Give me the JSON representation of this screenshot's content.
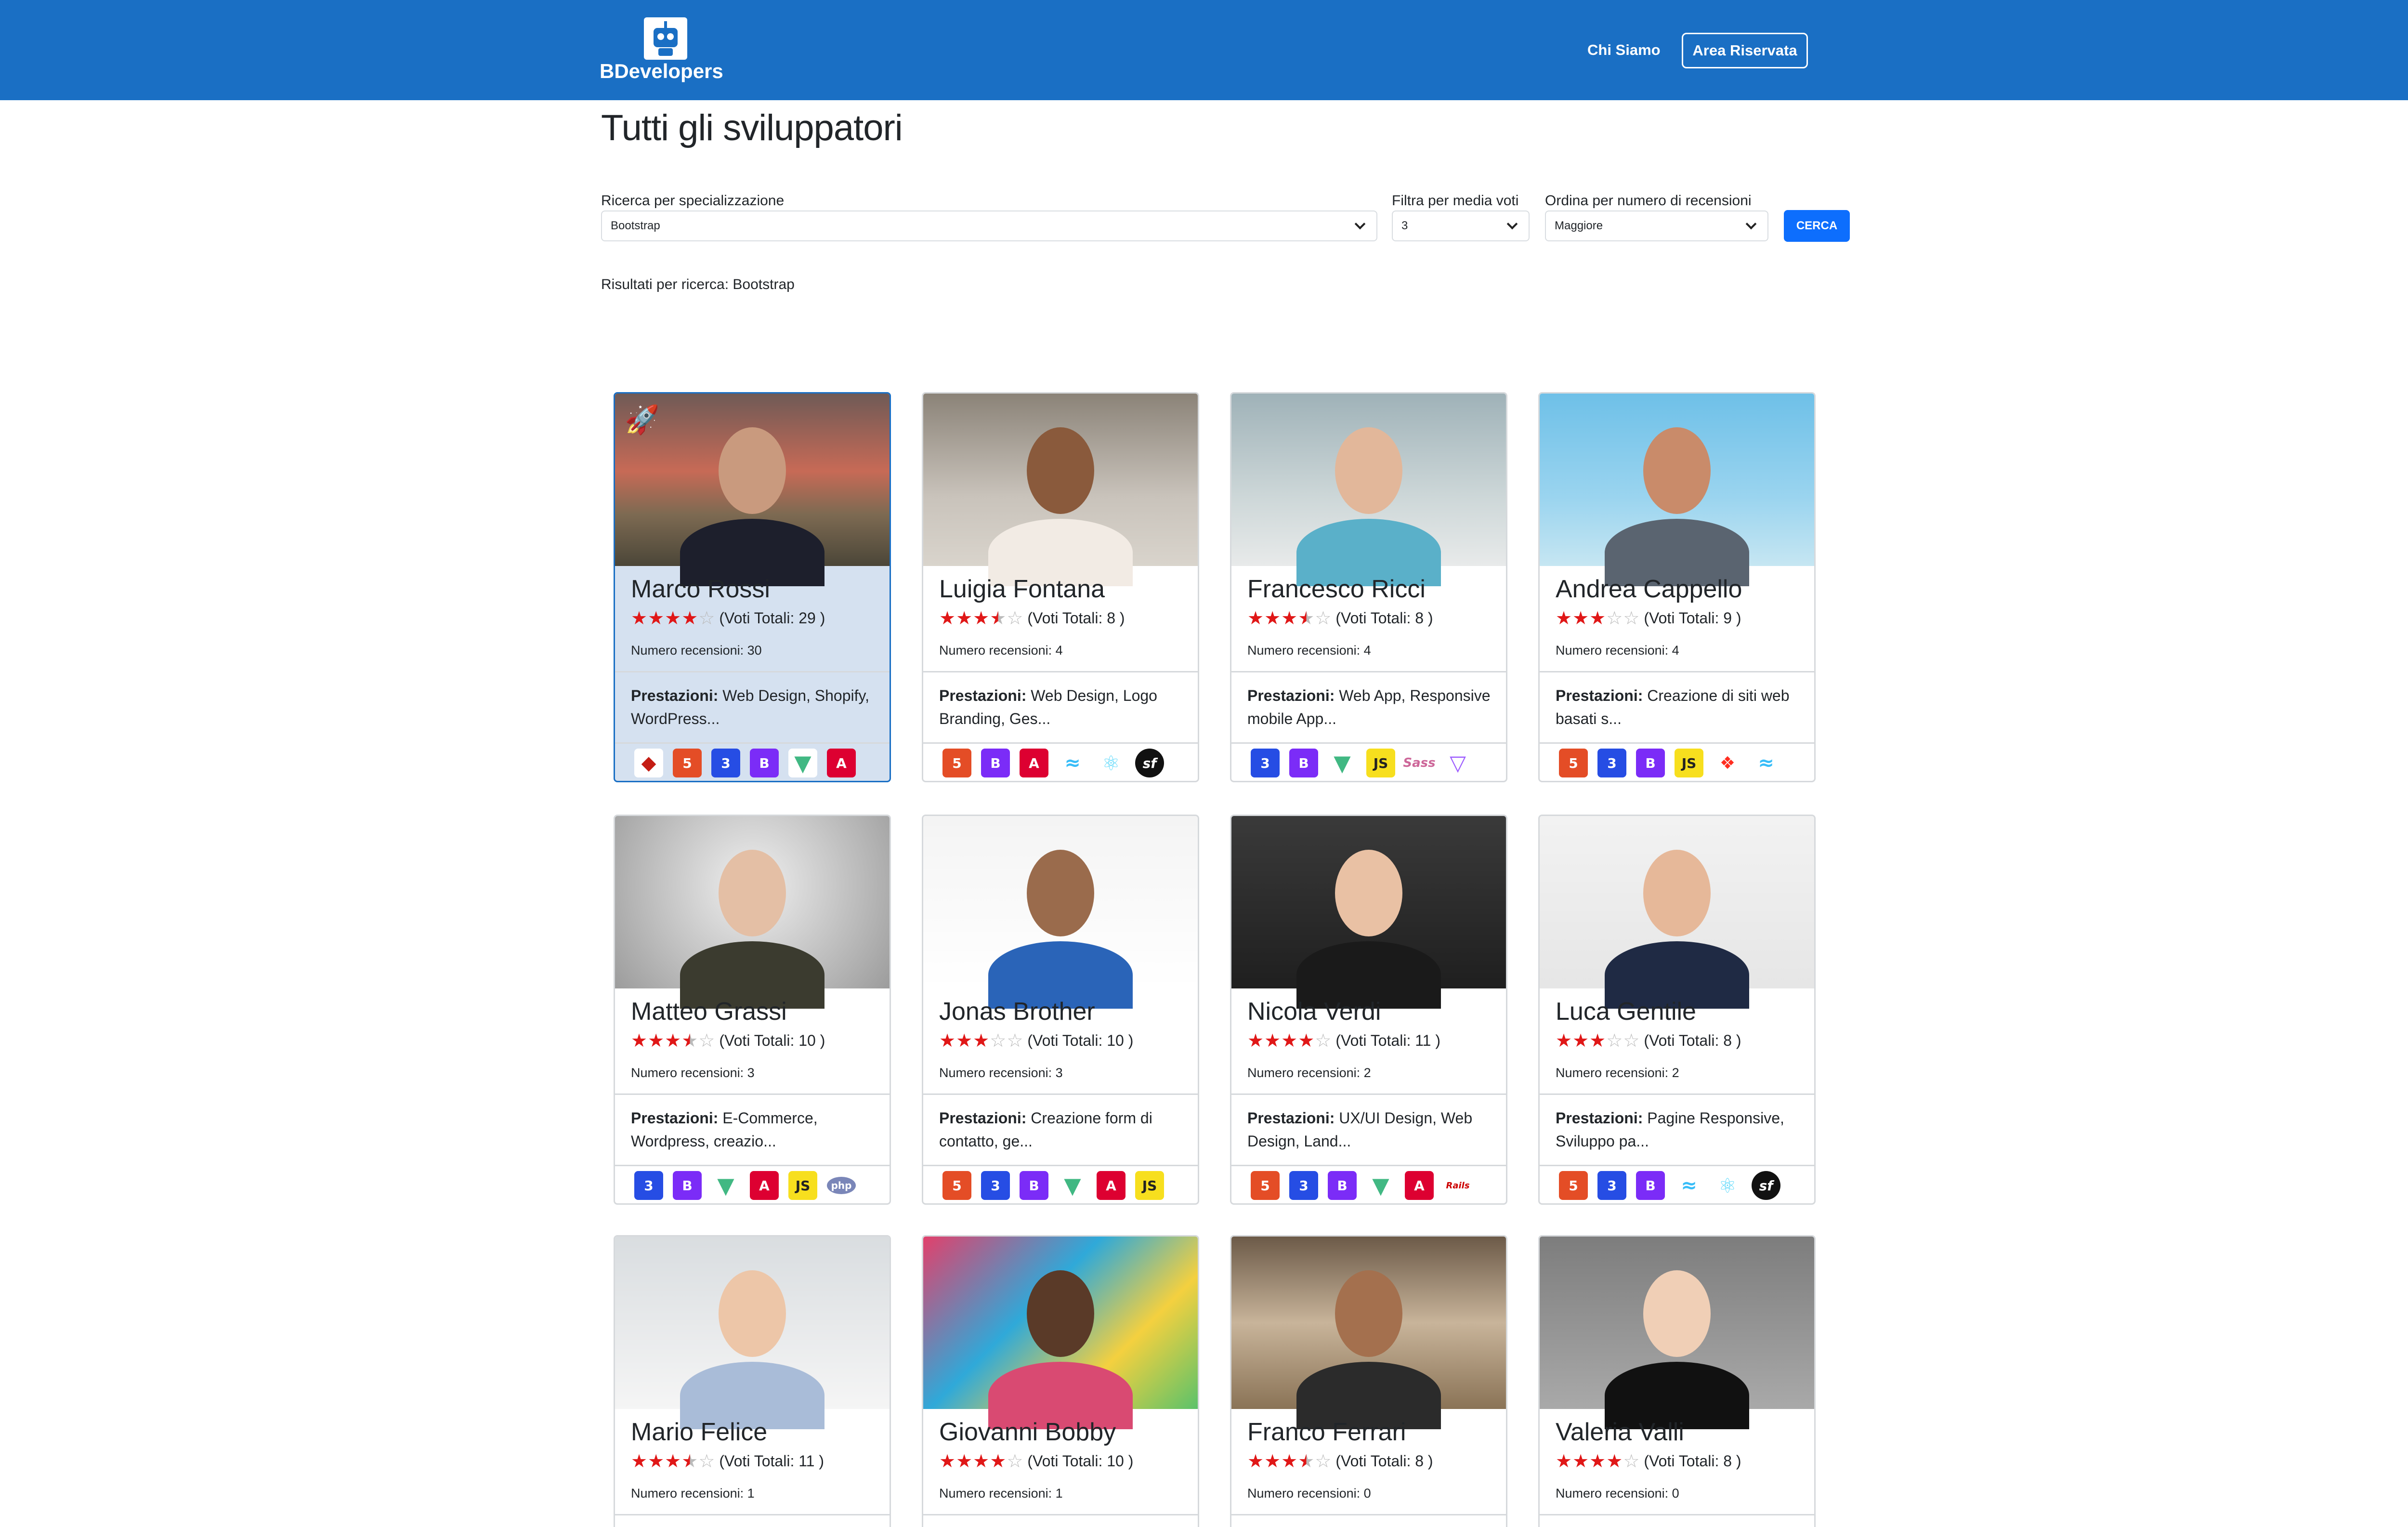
{
  "nav": {
    "brand": "BDevelopers",
    "link_about": "Chi Siamo",
    "button_reserved": "Area Riservata"
  },
  "page": {
    "title": "Tutti gli sviluppatori",
    "results_text": "Risultati per ricerca: Bootstrap"
  },
  "filters": {
    "specialization": {
      "label": "Ricerca per specializzazione",
      "value": "Bootstrap"
    },
    "rating": {
      "label": "Filtra per media voti",
      "value": "3"
    },
    "order": {
      "label": "Ordina per numero di recensioni",
      "value": "Maggiore"
    },
    "search_button": "CERCA"
  },
  "colors": {
    "navbar": "#1a6fc4",
    "featured_bg": "#d5e1f0",
    "star": "#e01717",
    "button": "#0d6efd"
  },
  "cards": [
    {
      "name": "Marco Rossi",
      "stars": 4,
      "votes": "(Voti Totali: 29 )",
      "reviews": "Numero recensioni: 30",
      "services_label": "Prestazioni:",
      "services": " Web Design, Shopify, WordPress...",
      "featured": true,
      "icons": [
        "ruby",
        "html",
        "css",
        "bootstrap",
        "vue",
        "angular"
      ]
    },
    {
      "name": "Luigia Fontana",
      "stars": 3.5,
      "votes": "(Voti Totali: 8 )",
      "reviews": "Numero recensioni: 4",
      "services_label": "Prestazioni:",
      "services": " Web Design, Logo Branding, Ges...",
      "featured": false,
      "icons": [
        "html",
        "bootstrap",
        "angular",
        "tailwind",
        "react",
        "symfony"
      ]
    },
    {
      "name": "Francesco Ricci",
      "stars": 3.5,
      "votes": "(Voti Totali: 8 )",
      "reviews": "Numero recensioni: 4",
      "services_label": "Prestazioni:",
      "services": " Web App, Responsive mobile App...",
      "featured": false,
      "icons": [
        "css",
        "bootstrap",
        "vue",
        "js",
        "sass",
        "vite"
      ]
    },
    {
      "name": "Andrea Cappello",
      "stars": 3,
      "votes": "(Voti Totali: 9 )",
      "reviews": "Numero recensioni: 4",
      "services_label": "Prestazioni:",
      "services": " Creazione di siti web basati s...",
      "featured": false,
      "icons": [
        "html",
        "css",
        "bootstrap",
        "js",
        "laravel",
        "tailwind"
      ]
    },
    {
      "name": "Matteo Grassi",
      "stars": 3.5,
      "votes": "(Voti Totali: 10 )",
      "reviews": "Numero recensioni: 3",
      "services_label": "Prestazioni:",
      "services": " E-Commerce, Wordpress, creazio...",
      "featured": false,
      "icons": [
        "css",
        "bootstrap",
        "vue",
        "angular",
        "js",
        "php"
      ]
    },
    {
      "name": "Jonas Brother",
      "stars": 3,
      "votes": "(Voti Totali: 10 )",
      "reviews": "Numero recensioni: 3",
      "services_label": "Prestazioni:",
      "services": " Creazione form di contatto, ge...",
      "featured": false,
      "icons": [
        "html",
        "css",
        "bootstrap",
        "vue",
        "angular",
        "js"
      ]
    },
    {
      "name": "Nicola Verdi",
      "stars": 4,
      "votes": "(Voti Totali: 11 )",
      "reviews": "Numero recensioni: 2",
      "services_label": "Prestazioni:",
      "services": " UX/UI Design, Web Design, Land...",
      "featured": false,
      "icons": [
        "html",
        "css",
        "bootstrap",
        "vue",
        "angular",
        "rails"
      ]
    },
    {
      "name": "Luca Gentile",
      "stars": 3,
      "votes": "(Voti Totali: 8 )",
      "reviews": "Numero recensioni: 2",
      "services_label": "Prestazioni:",
      "services": " Pagine Responsive, Sviluppo pa...",
      "featured": false,
      "icons": [
        "html",
        "css",
        "bootstrap",
        "tailwind",
        "react",
        "symfony"
      ]
    },
    {
      "name": "Mario Felice",
      "stars": 3.5,
      "votes": "(Voti Totali: 11 )",
      "reviews": "Numero recensioni: 1",
      "featured": false
    },
    {
      "name": "Giovanni Bobby",
      "stars": 4,
      "votes": "(Voti Totali: 10 )",
      "reviews": "Numero recensioni: 1",
      "featured": false
    },
    {
      "name": "Franco Ferrari",
      "stars": 3.5,
      "votes": "(Voti Totali: 8 )",
      "reviews": "Numero recensioni: 0",
      "featured": false
    },
    {
      "name": "Valeria Valli",
      "stars": 4,
      "votes": "(Voti Totali: 8 )",
      "reviews": "Numero recensioni: 0",
      "featured": false
    }
  ]
}
